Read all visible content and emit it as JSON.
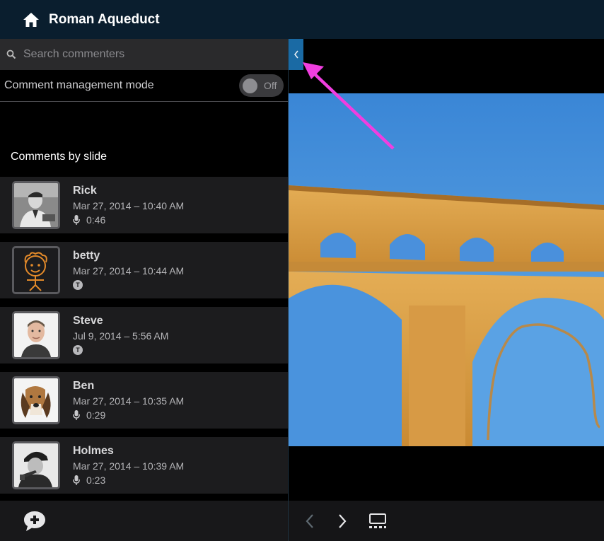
{
  "app": {
    "title": "Roman Aqueduct"
  },
  "search": {
    "placeholder": "Search commenters"
  },
  "management": {
    "label": "Comment management mode",
    "toggle_state": "Off"
  },
  "comments_section": {
    "heading": "Comments by slide"
  },
  "comments": [
    {
      "name": "Rick",
      "date": "Mar 27, 2014 – 10:40 AM",
      "type": "audio",
      "duration": "0:46"
    },
    {
      "name": "betty",
      "date": "Mar 27, 2014 – 10:44 AM",
      "type": "text",
      "badge": "T"
    },
    {
      "name": "Steve",
      "date": "Jul 9, 2014 – 5:56 AM",
      "type": "text",
      "badge": "T"
    },
    {
      "name": "Ben",
      "date": "Mar 27, 2014 – 10:35 AM",
      "type": "audio",
      "duration": "0:29"
    },
    {
      "name": "Holmes",
      "date": "Mar 27, 2014 – 10:39 AM",
      "type": "audio",
      "duration": "0:23"
    }
  ],
  "icons": {
    "home": "home-icon",
    "search": "search-icon",
    "mic": "microphone-icon",
    "add_comment": "add-comment-icon",
    "collapse": "chevron-left-icon",
    "prev": "chevron-left-icon",
    "next": "chevron-right-icon",
    "slides": "slide-sorter-icon"
  },
  "colors": {
    "topbar": "#0a1e2e",
    "accent": "#1a6aa4",
    "annotation_arrow": "#f03ee0",
    "sky": "#3f8fd8",
    "stone": "#d9a04a"
  }
}
